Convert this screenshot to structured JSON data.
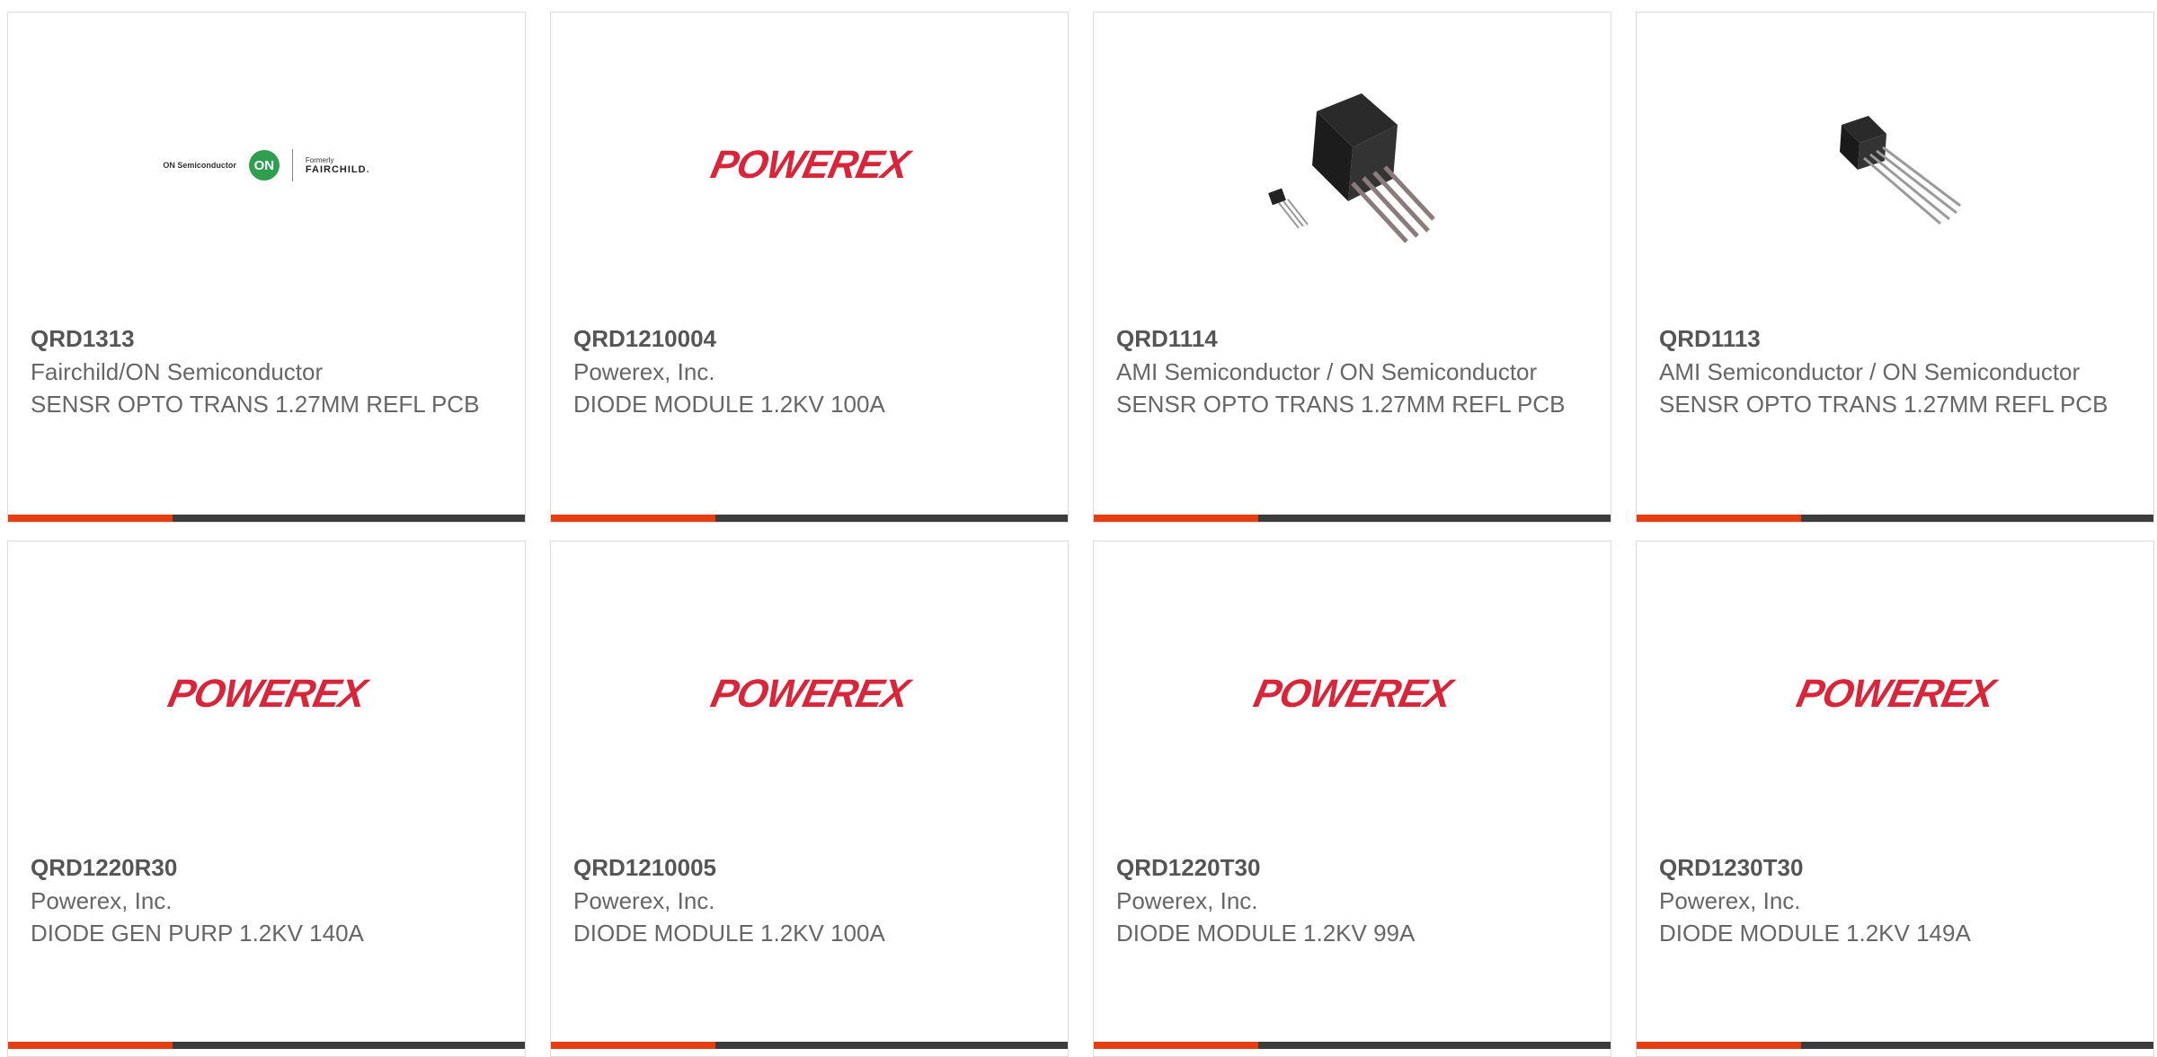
{
  "products": [
    {
      "part": "QRD1313",
      "mfr": "Fairchild/ON Semiconductor",
      "desc": "SENSR OPTO TRANS 1.27MM REFL PCB",
      "image": "onsemi-fairchild-logo",
      "logo": {
        "left": "ON Semiconductor",
        "circle": "ON",
        "small": "Formerly",
        "name_a": "FAIRCHILD",
        "name_b": "."
      }
    },
    {
      "part": "QRD1210004",
      "mfr": "Powerex, Inc.",
      "desc": "DIODE MODULE 1.2KV 100A",
      "image": "powerex-logo",
      "logo_text": "POWEREX"
    },
    {
      "part": "QRD1114",
      "mfr": "AMI Semiconductor / ON Semiconductor",
      "desc": "SENSR OPTO TRANS 1.27MM REFL PCB",
      "image": "optical-sensor-photo-large"
    },
    {
      "part": "QRD1113",
      "mfr": "AMI Semiconductor / ON Semiconductor",
      "desc": "SENSR OPTO TRANS 1.27MM REFL PCB",
      "image": "optical-sensor-photo-small"
    },
    {
      "part": "QRD1220R30",
      "mfr": "Powerex, Inc.",
      "desc": "DIODE GEN PURP 1.2KV 140A",
      "image": "powerex-logo",
      "logo_text": "POWEREX"
    },
    {
      "part": "QRD1210005",
      "mfr": "Powerex, Inc.",
      "desc": "DIODE MODULE 1.2KV 100A",
      "image": "powerex-logo",
      "logo_text": "POWEREX"
    },
    {
      "part": "QRD1220T30",
      "mfr": "Powerex, Inc.",
      "desc": "DIODE MODULE 1.2KV 99A",
      "image": "powerex-logo",
      "logo_text": "POWEREX"
    },
    {
      "part": "QRD1230T30",
      "mfr": "Powerex, Inc.",
      "desc": "DIODE MODULE 1.2KV 149A",
      "image": "powerex-logo",
      "logo_text": "POWEREX"
    }
  ],
  "colors": {
    "accent_bar": "#e63e12",
    "bar": "#3c3c3c",
    "powerex_red": "#d8253a",
    "on_green": "#2f9e4f"
  }
}
